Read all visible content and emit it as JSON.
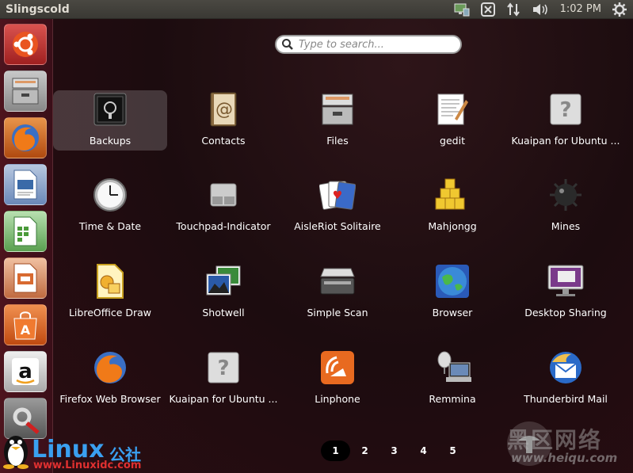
{
  "window": {
    "title": "Slingscold"
  },
  "tray": {
    "clock": "1:02 PM"
  },
  "search": {
    "placeholder": "Type to search..."
  },
  "apps": [
    {
      "label": "Backups",
      "icon": "safe-icon",
      "selected": true
    },
    {
      "label": "Contacts",
      "icon": "address-book-icon"
    },
    {
      "label": "Files",
      "icon": "file-cabinet-icon"
    },
    {
      "label": "gedit",
      "icon": "text-editor-icon"
    },
    {
      "label": "Kuaipan for Ubuntu ...",
      "icon": "unknown-app-icon"
    },
    {
      "label": "Time & Date",
      "icon": "clock-icon"
    },
    {
      "label": "Touchpad-Indicator",
      "icon": "touchpad-icon"
    },
    {
      "label": "AisleRiot Solitaire",
      "icon": "playing-cards-icon"
    },
    {
      "label": "Mahjongg",
      "icon": "mahjong-tiles-icon"
    },
    {
      "label": "Mines",
      "icon": "mine-icon"
    },
    {
      "label": "LibreOffice Draw",
      "icon": "libreoffice-draw-icon"
    },
    {
      "label": "Shotwell",
      "icon": "photos-icon"
    },
    {
      "label": "Simple Scan",
      "icon": "scanner-icon"
    },
    {
      "label": "Browser",
      "icon": "globe-icon"
    },
    {
      "label": "Desktop Sharing",
      "icon": "monitor-icon"
    },
    {
      "label": "Firefox Web Browser",
      "icon": "firefox-icon"
    },
    {
      "label": "Kuaipan for Ubuntu ...",
      "icon": "unknown-app-icon"
    },
    {
      "label": "Linphone",
      "icon": "linphone-icon"
    },
    {
      "label": "Remmina",
      "icon": "remote-desktop-icon"
    },
    {
      "label": "Thunderbird Mail",
      "icon": "thunderbird-icon"
    }
  ],
  "pages": [
    "1",
    "2",
    "3",
    "4",
    "5"
  ],
  "current_page": "1",
  "watermarks": {
    "linux_brand": "Linux",
    "linux_cn": "公社",
    "linux_url": "www.Linuxidc.com",
    "heiqu_cn": "黑区网络",
    "heiqu_url": "www.heiqu.com"
  }
}
